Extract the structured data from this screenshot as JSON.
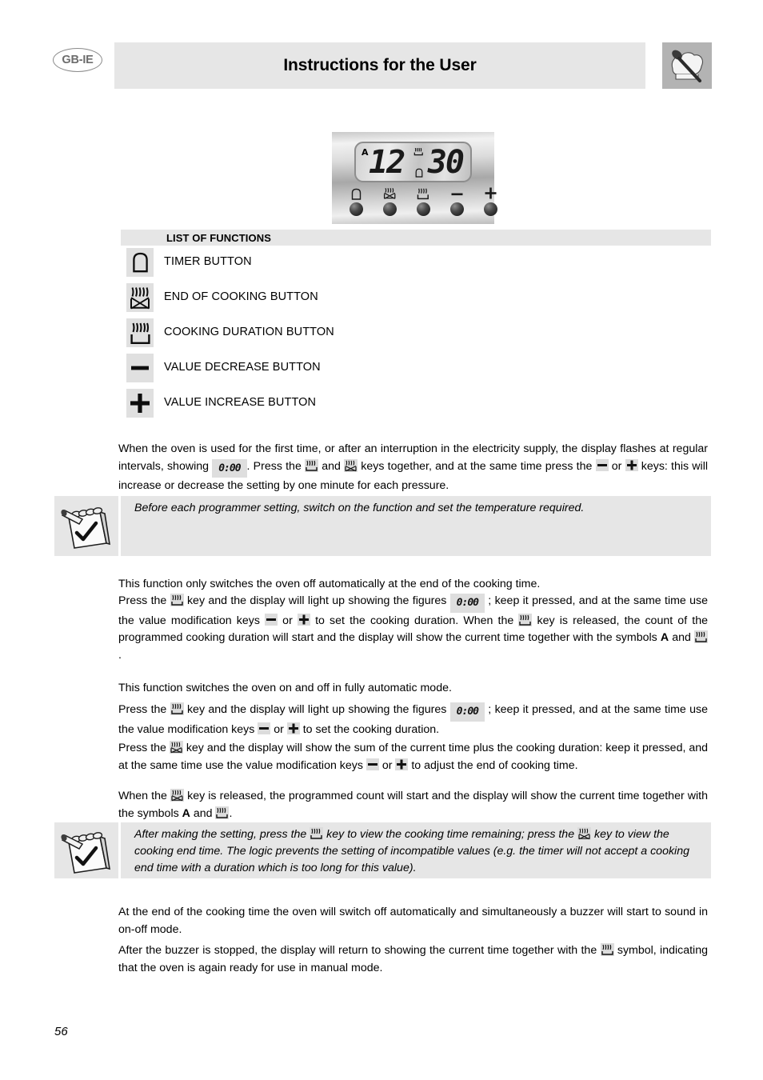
{
  "header": {
    "language_badge": "GB-IE",
    "title": "Instructions for the User",
    "right_icon": "chef-hat-spoon-icon"
  },
  "programmer_panel": {
    "display": {
      "auto_indicator": "A",
      "hours": "12",
      "minutes": "30",
      "top_symbol": "cooking-duration-icon",
      "bottom_symbol": "timer-bell-icon"
    },
    "buttons": [
      {
        "icon": "timer-bell-icon",
        "name": "timer-button"
      },
      {
        "icon": "end-of-cooking-icon",
        "name": "end-of-cooking-button"
      },
      {
        "icon": "cooking-duration-icon",
        "name": "cooking-duration-button"
      },
      {
        "icon": "minus-icon",
        "name": "value-decrease-button"
      },
      {
        "icon": "plus-icon",
        "name": "value-increase-button"
      }
    ]
  },
  "list_of_functions": {
    "heading": "LIST OF FUNCTIONS",
    "items": [
      {
        "icon": "timer-bell-icon",
        "label": "TIMER BUTTON"
      },
      {
        "icon": "end-of-cooking-icon",
        "label": "END OF COOKING BUTTON"
      },
      {
        "icon": "cooking-duration-icon",
        "label": "COOKING DURATION BUTTON"
      },
      {
        "icon": "minus-icon",
        "label": "VALUE DECREASE BUTTON"
      },
      {
        "icon": "plus-icon",
        "label": "VALUE INCREASE BUTTON"
      }
    ]
  },
  "content": {
    "intro_p1_a": "When the oven is used for the first time, or after an interruption in the electricity supply, the display flashes at regular intervals, showing ",
    "intro_p1_lcd": "0:00",
    "intro_p1_b": ". Press the ",
    "intro_p1_c": " and ",
    "intro_p1_d": " keys together, and at the same time press the ",
    "intro_p1_e": " or ",
    "intro_p1_f": " keys: this will increase or decrease the setting by one minute for each pressure.",
    "note1": "Before each programmer setting, switch on the function and set the temperature required.",
    "sec1_line1": "This function only switches the oven off automatically at the end of the cooking time.",
    "sec1_a": "Press the ",
    "sec1_b": " key and the display will light up showing the figures ",
    "sec1_lcd": "0:00",
    "sec1_c": " ; keep it pressed, and at the same time use the value modification keys ",
    "sec1_d": " or ",
    "sec1_e": " to set the cooking duration. When the ",
    "sec1_f": " key is released, the count of the programmed cooking duration will start and the display will show the current time together with the symbols ",
    "sec1_bold_a": "A",
    "sec1_g": " and ",
    "sec1_h": ".",
    "sec2_line1": "This function switches the oven on and off in fully automatic mode.",
    "sec2_a": "Press the ",
    "sec2_b": " key and the display will light up showing the figures ",
    "sec2_lcd": "0:00",
    "sec2_c": " ; keep it pressed, and at the same time use the value modification keys ",
    "sec2_d": " or ",
    "sec2_e": " to set the cooking duration.",
    "sec2_f": "Press the ",
    "sec2_g": " key and the display will show the sum of the current time plus the cooking duration: keep it pressed, and at the same time use the value modification keys ",
    "sec2_h": " or ",
    "sec2_i": " to adjust the end of cooking time.",
    "sec2_j": "When the ",
    "sec2_k": " key is released, the programmed count will start and the display will show the current time together with the symbols ",
    "sec2_bold_a": "A",
    "sec2_l": " and ",
    "sec2_m": ".",
    "note2_a": "After making the setting, press the ",
    "note2_b": " key to view the cooking time remaining; press the ",
    "note2_c": " key to view the cooking end time. The logic prevents the setting of incompatible values (e.g. the timer will not accept a cooking end time with a duration which is too long for this value).",
    "end_line1": "At the end of the cooking time the oven will switch off automatically and simultaneously a buzzer will start to sound in on-off mode.",
    "end_a": "After the buzzer is stopped, the display will return to showing the current time together with the ",
    "end_b": " symbol, indicating that the oven is again ready for use in manual mode."
  },
  "footer": {
    "page_number": "56"
  },
  "colors": {
    "panel_gray": "#e6e6e6",
    "icon_gray": "#e0e0e0",
    "chip_gray": "#dcdcdc",
    "header_icon_bg": "#b3b3b3"
  }
}
